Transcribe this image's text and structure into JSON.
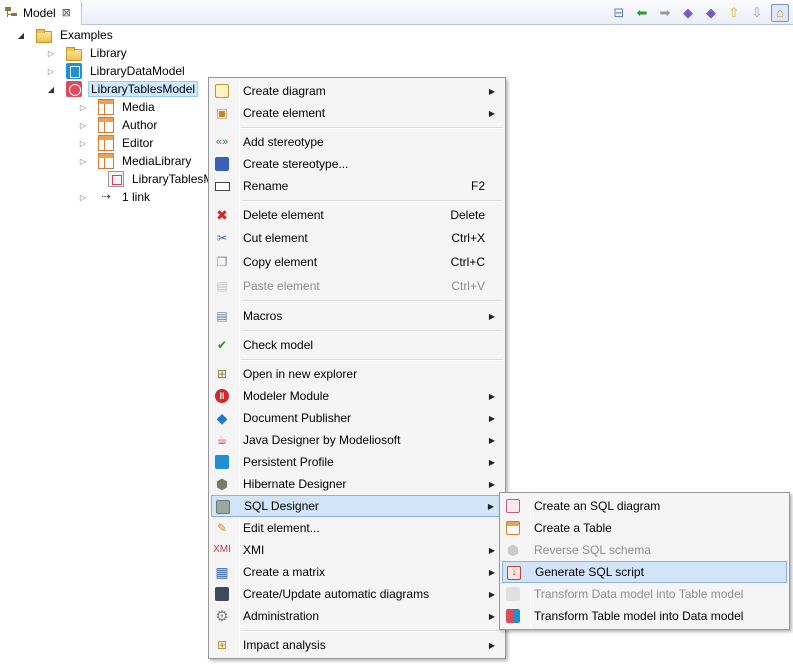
{
  "view_tab": {
    "title": "Model",
    "close": "⊠"
  },
  "tree": {
    "root": {
      "label": "Examples"
    },
    "library": {
      "label": "Library"
    },
    "data_model": {
      "label": "LibraryDataModel"
    },
    "tables_model": {
      "label": "LibraryTablesModel"
    },
    "children": [
      {
        "label": "Media"
      },
      {
        "label": "Author"
      },
      {
        "label": "Editor"
      },
      {
        "label": "MediaLibrary"
      },
      {
        "label": "LibraryTablesM"
      },
      {
        "label": "1 link"
      }
    ]
  },
  "menu": {
    "create_diagram": "Create diagram",
    "create_element": "Create element",
    "add_stereotype": "Add stereotype",
    "create_stereotype": "Create stereotype...",
    "rename": "Rename",
    "rename_accel": "F2",
    "delete_element": "Delete element",
    "delete_accel": "Delete",
    "cut_element": "Cut element",
    "cut_accel": "Ctrl+X",
    "copy_element": "Copy element",
    "copy_accel": "Ctrl+C",
    "paste_element": "Paste element",
    "paste_accel": "Ctrl+V",
    "macros": "Macros",
    "check_model": "Check model",
    "open_new_explorer": "Open in new explorer",
    "modeler_module": "Modeler Module",
    "document_publisher": "Document Publisher",
    "java_designer": "Java Designer by Modeliosoft",
    "persistent_profile": "Persistent Profile",
    "hibernate_designer": "Hibernate Designer",
    "sql_designer": "SQL Designer",
    "edit_element": "Edit element...",
    "xmi": "XMI",
    "create_matrix": "Create a matrix",
    "create_update_diagrams": "Create/Update automatic diagrams",
    "administration": "Administration",
    "impact_analysis": "Impact analysis"
  },
  "submenu": {
    "create_sql_diagram": "Create an SQL diagram",
    "create_table": "Create a Table",
    "reverse_sql_schema": "Reverse SQL schema",
    "generate_sql_script": "Generate SQL script",
    "transform_data_to_table": "Transform Data model into Table model",
    "transform_table_to_data": "Transform Table model into Data model"
  },
  "colors": {
    "selection_bg": "#d1e4f8",
    "selection_border": "#8cb3e0",
    "menu_bg": "#f5f5f5",
    "disabled_text": "#8d8d8d"
  }
}
